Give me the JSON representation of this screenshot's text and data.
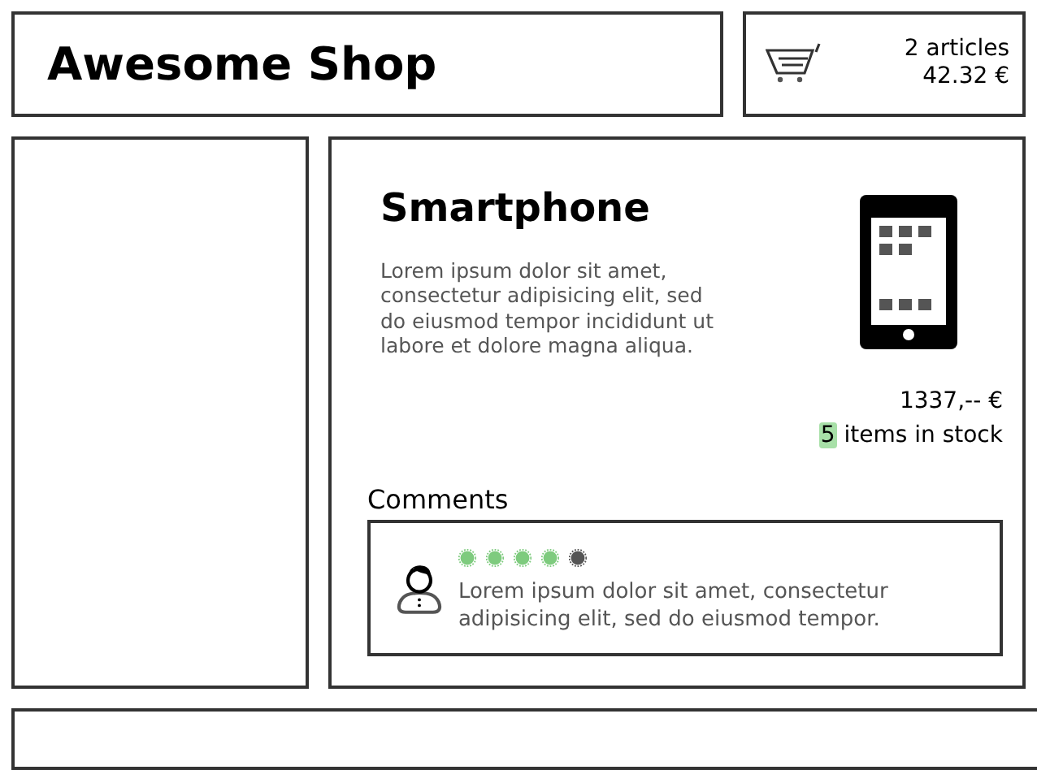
{
  "header": {
    "title": "Awesome Shop"
  },
  "cart": {
    "articles": "2 articles",
    "total": "42.32 €"
  },
  "product": {
    "title": "Smartphone",
    "description": "Lorem ipsum dolor sit amet, consectetur adipisicing elit, sed do eiusmod tempor incididunt ut labore et dolore magna aliqua.",
    "price": "1337,-- €",
    "stock_count": "5",
    "stock_label": "items in stock"
  },
  "comments": {
    "heading": "Comments",
    "items": [
      {
        "stars": 4,
        "text": "Lorem ipsum dolor sit amet, consectetur adipisicing elit, sed do eiusmod tempor."
      }
    ]
  }
}
